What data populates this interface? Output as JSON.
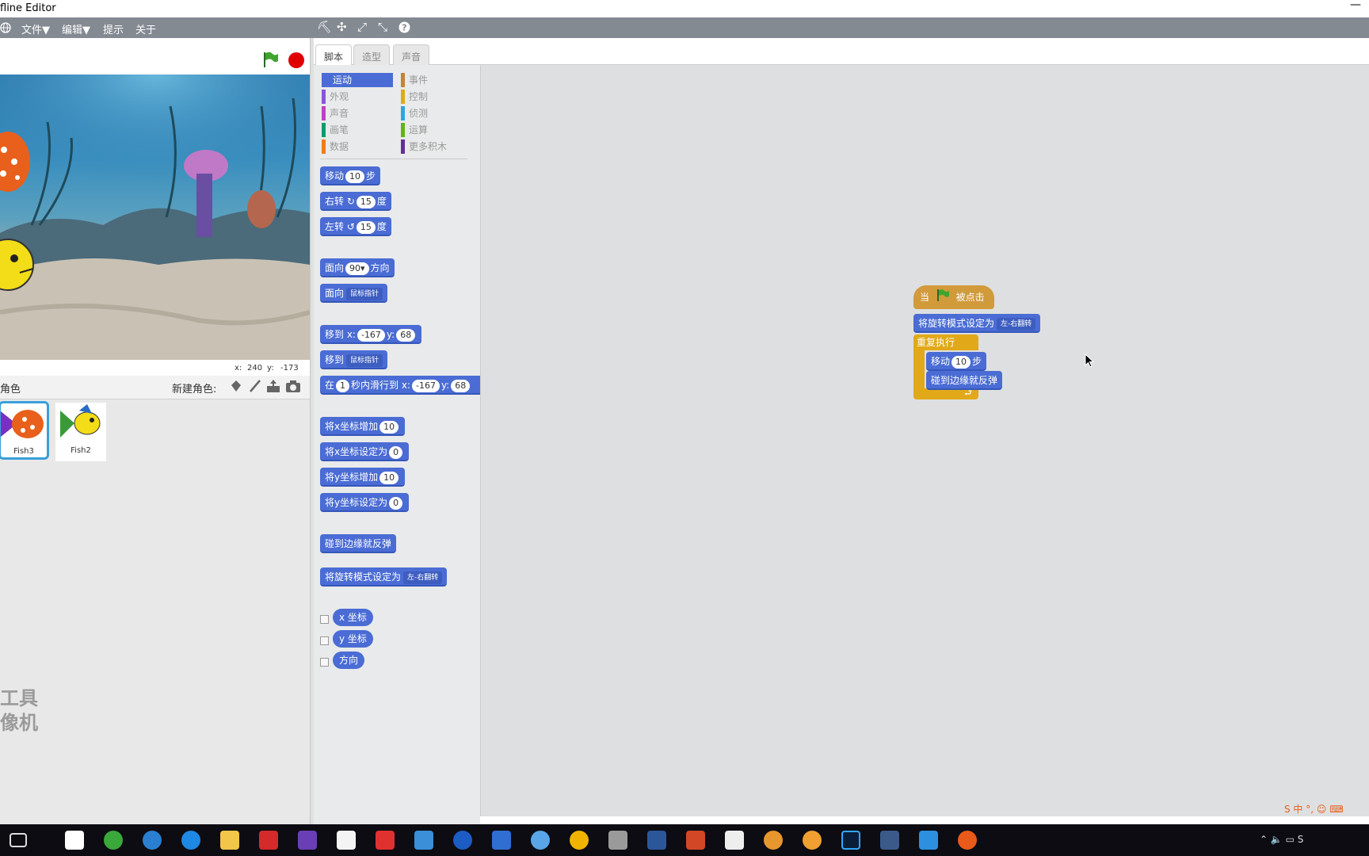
{
  "window": {
    "title": "fline Editor",
    "minimize": "—"
  },
  "menu": {
    "file": "文件▼",
    "edit": "编辑▼",
    "tips": "提示",
    "about": "关于"
  },
  "stage": {
    "x_label": "x:",
    "x_value": "240",
    "y_label": "y:",
    "y_value": "-173"
  },
  "sprites": {
    "header": "角色",
    "new_sprite": "新建角色:",
    "items": [
      {
        "name": "Fish3"
      },
      {
        "name": "Fish2"
      }
    ]
  },
  "tabs": [
    {
      "label": "脚本"
    },
    {
      "label": "造型"
    },
    {
      "label": "声音"
    }
  ],
  "categories": [
    {
      "label": "运动",
      "color": "#4a6cd4"
    },
    {
      "label": "外观",
      "color": "#8a55d7"
    },
    {
      "label": "声音",
      "color": "#bb42c3"
    },
    {
      "label": "画笔",
      "color": "#0e9a6c"
    },
    {
      "label": "数据",
      "color": "#ee7d16"
    },
    {
      "label": "事件",
      "color": "#c88330"
    },
    {
      "label": "控制",
      "color": "#e1a91a"
    },
    {
      "label": "侦测",
      "color": "#2ca5e2"
    },
    {
      "label": "运算",
      "color": "#5cb712"
    },
    {
      "label": "更多积木",
      "color": "#632d99"
    }
  ],
  "blocks": {
    "move": {
      "pre": "移动",
      "val": "10",
      "post": "步"
    },
    "turn_right": {
      "pre": "右转",
      "icon": "↻",
      "val": "15",
      "post": "度"
    },
    "turn_left": {
      "pre": "左转",
      "icon": "↺",
      "val": "15",
      "post": "度"
    },
    "point_dir": {
      "pre": "面向",
      "val": "90▾",
      "post": "方向"
    },
    "point_towards": {
      "pre": "面向",
      "dd": "鼠标指针"
    },
    "goto_xy": {
      "pre": "移到 x:",
      "x": "-167",
      "mid": "y:",
      "y": "68"
    },
    "goto": {
      "pre": "移到",
      "dd": "鼠标指针"
    },
    "glide": {
      "pre": "在",
      "secs": "1",
      "mid": "秒内滑行到 x:",
      "x": "-167",
      "mid2": "y:",
      "y": "68"
    },
    "change_x": {
      "pre": "将x坐标增加",
      "val": "10"
    },
    "set_x": {
      "pre": "将x坐标设定为",
      "val": "0"
    },
    "change_y": {
      "pre": "将y坐标增加",
      "val": "10"
    },
    "set_y": {
      "pre": "将y坐标设定为",
      "val": "0"
    },
    "bounce": {
      "label": "碰到边缘就反弹"
    },
    "rotation_style": {
      "pre": "将旋转模式设定为",
      "dd": "左-右翻转"
    },
    "rep_x": {
      "label": "x 坐标"
    },
    "rep_y": {
      "label": "y 坐标"
    },
    "rep_dir": {
      "label": "方向"
    }
  },
  "script": {
    "hat_pre": "当",
    "hat_post": "被点击",
    "rotation": {
      "pre": "将旋转模式设定为",
      "dd": "左-右翻转"
    },
    "forever": "重复执行",
    "move": {
      "pre": "移动",
      "val": "10",
      "post": "步"
    },
    "bounce": "碰到边缘就反弹"
  },
  "overlay": {
    "line1": "工具",
    "line2": "像机"
  }
}
